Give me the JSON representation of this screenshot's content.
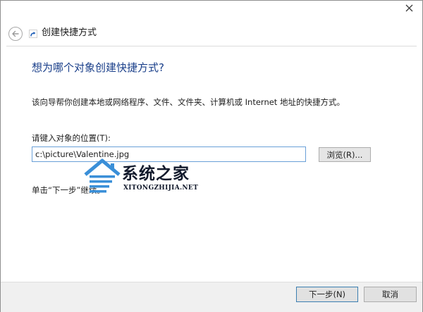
{
  "window": {
    "title": "创建快捷方式",
    "close_icon": "close-icon",
    "back_icon": "back-arrow-icon",
    "title_icon": "shortcut-icon"
  },
  "content": {
    "heading": "想为哪个对象创建快捷方式?",
    "description": "该向导帮你创建本地或网络程序、文件、文件夹、计算机或 Internet 地址的快捷方式。",
    "location_label": "请键入对象的位置(T):",
    "location_value": "c:\\picture\\Valentine.jpg",
    "browse_label": "浏览(R)...",
    "hint": "单击“下一步”继续。"
  },
  "watermark": {
    "title": "系统之家",
    "url": "XITONGZHIJIA.NET",
    "icon": "house-logo-icon"
  },
  "footer": {
    "next_label": "下一步(N)",
    "cancel_label": "取消"
  },
  "colors": {
    "heading": "#1a3f8a",
    "input_border": "#6aa0d8",
    "default_button_border": "#3c7fb1",
    "footer_background": "#f0f0f0"
  }
}
